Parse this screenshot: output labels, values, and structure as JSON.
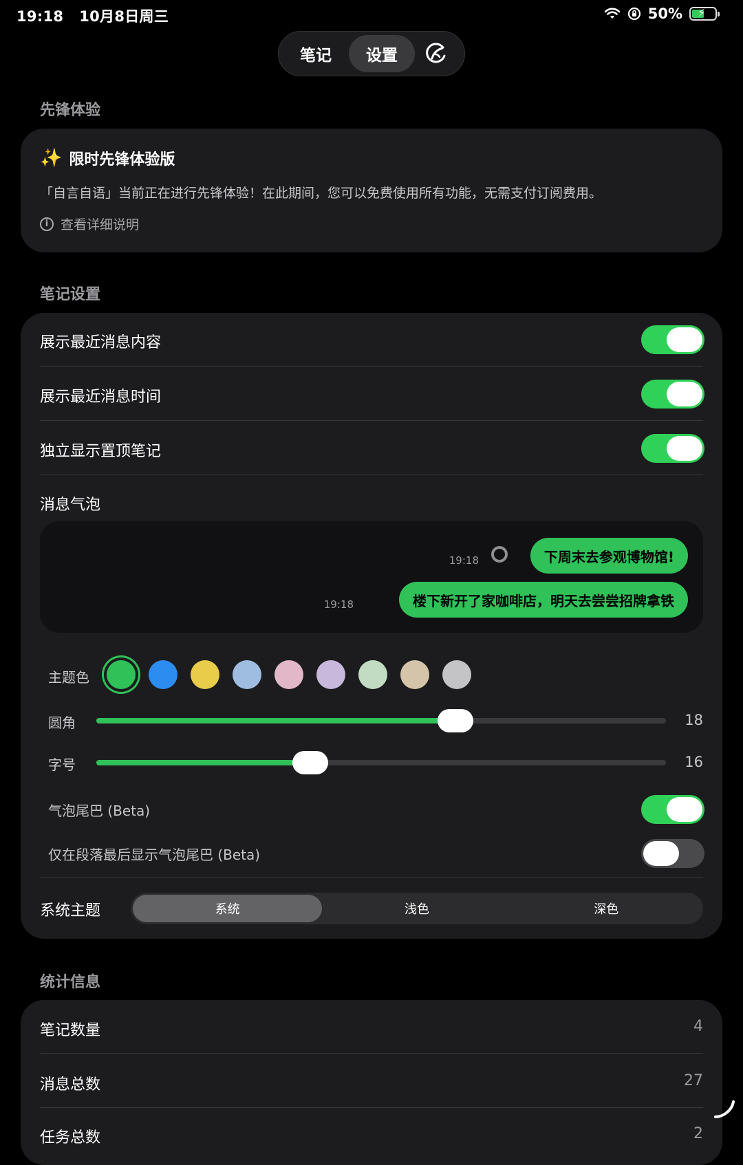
{
  "status_bar": {
    "time": "19:18",
    "date": "10月8日周三",
    "battery": "50%"
  },
  "top_nav": {
    "tabs": [
      {
        "label": "笔记",
        "active": false
      },
      {
        "label": "设置",
        "active": true
      }
    ],
    "icon": "leaf-chart-icon"
  },
  "pioneer": {
    "section_title": "先锋体验",
    "card_title": "限时先锋体验版",
    "description": "「自言自语」当前正在进行先锋体验！在此期间，您可以免费使用所有功能，无需支付订阅费用。",
    "link": "查看详细说明"
  },
  "note_settings": {
    "section_title": "笔记设置",
    "toggles": [
      {
        "label": "展示最近消息内容",
        "on": true
      },
      {
        "label": "展示最近消息时间",
        "on": true
      },
      {
        "label": "独立显示置顶笔记",
        "on": true
      }
    ],
    "bubble_section": "消息气泡",
    "preview": [
      {
        "time": "19:18",
        "text": "下周末去参观博物馆!"
      },
      {
        "time": "19:18",
        "text": "楼下新开了家咖啡店，明天去尝尝招牌拿铁"
      }
    ],
    "theme_label": "主题色",
    "theme_colors": [
      "#30c158",
      "#2d8cf0",
      "#e8cc4a",
      "#9fbde0",
      "#e2b8c8",
      "#c8b8dc",
      "#c2dcc4",
      "#d4c4aa",
      "#c4c4c6"
    ],
    "selected_theme": 0,
    "sliders": [
      {
        "label": "圆角",
        "value": "18",
        "fraction": 0.63
      },
      {
        "label": "字号",
        "value": "16",
        "fraction": 0.375
      }
    ],
    "bubble_tail": {
      "label": "气泡尾巴 (Beta)",
      "on": true
    },
    "tail_last_only": {
      "label": "仅在段落最后显示气泡尾巴 (Beta)",
      "on": false
    },
    "system_theme": {
      "label": "系统主题",
      "options": [
        "系统",
        "浅色",
        "深色"
      ],
      "selected": 0
    }
  },
  "stats": {
    "section_title": "统计信息",
    "rows": [
      {
        "label": "笔记数量",
        "value": "4"
      },
      {
        "label": "消息总数",
        "value": "27"
      },
      {
        "label": "任务总数",
        "value": "2"
      }
    ]
  }
}
